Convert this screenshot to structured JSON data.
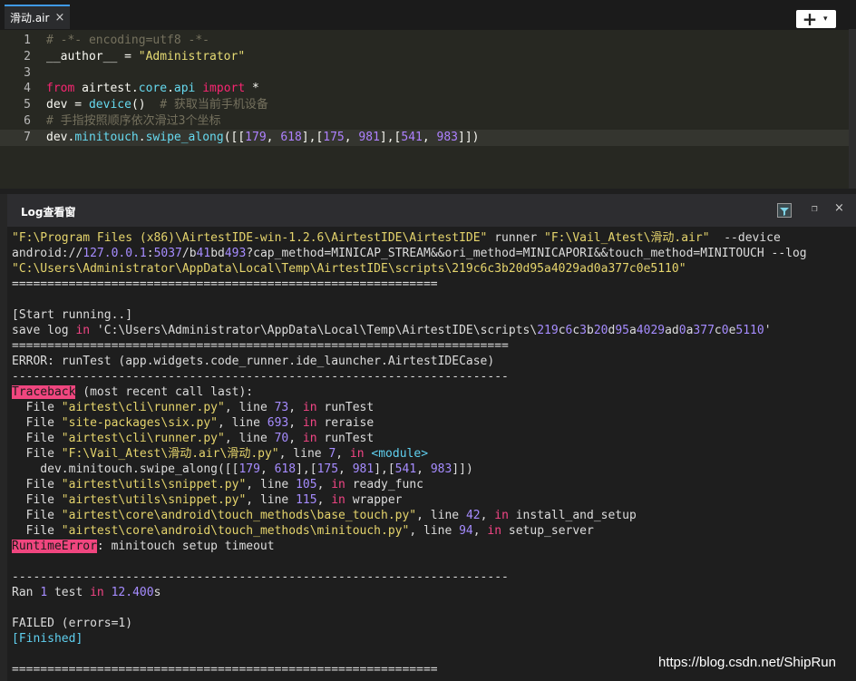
{
  "tab": {
    "title": "滑动.air",
    "close": "×"
  },
  "toolbar": {
    "add": "+",
    "dropdown": "▾"
  },
  "editor": {
    "lines": [
      {
        "num": "1",
        "parts": [
          [
            "c-comment",
            "# -*- encoding=utf8 -*-"
          ]
        ]
      },
      {
        "num": "2",
        "parts": [
          [
            "",
            "__author__ = "
          ],
          [
            "c-str",
            "\"Administrator\""
          ]
        ]
      },
      {
        "num": "3",
        "parts": [
          [
            "",
            ""
          ]
        ]
      },
      {
        "num": "4",
        "parts": [
          [
            "c-kw",
            "from"
          ],
          [
            "",
            " airtest."
          ],
          [
            "c-fn",
            "core"
          ],
          [
            "",
            "."
          ],
          [
            "c-fn",
            "api"
          ],
          [
            "",
            " "
          ],
          [
            "c-kw",
            "import"
          ],
          [
            "",
            " *"
          ]
        ]
      },
      {
        "num": "5",
        "parts": [
          [
            "",
            "dev = "
          ],
          [
            "c-fn",
            "device"
          ],
          [
            "",
            "()  "
          ],
          [
            "c-comment",
            "# 获取当前手机设备"
          ]
        ]
      },
      {
        "num": "6",
        "parts": [
          [
            "c-comment",
            "# 手指按照顺序依次滑过3个坐标"
          ]
        ]
      },
      {
        "num": "7",
        "current": true,
        "parts": [
          [
            "",
            "dev."
          ],
          [
            "c-fn",
            "minitouch"
          ],
          [
            "",
            "."
          ],
          [
            "c-fn",
            "swipe_along"
          ],
          [
            "",
            "([["
          ],
          [
            "c-num",
            "179"
          ],
          [
            "",
            ", "
          ],
          [
            "c-num",
            "618"
          ],
          [
            "",
            "],["
          ],
          [
            "c-num",
            "175"
          ],
          [
            "",
            ", "
          ],
          [
            "c-num",
            "981"
          ],
          [
            "",
            "],["
          ],
          [
            "c-num",
            "541"
          ],
          [
            "",
            ", "
          ],
          [
            "c-num",
            "983"
          ],
          [
            "",
            "]])"
          ]
        ]
      }
    ]
  },
  "log": {
    "title": "Log查看窗",
    "restore": "❐",
    "close": "×",
    "lines": [
      [
        [
          "y",
          "\"F:\\Program Files (x86)\\AirtestIDE-win-1.2.6\\AirtestIDE\\AirtestIDE\""
        ],
        [
          "",
          " runner "
        ],
        [
          "y",
          "\"F:\\Vail_Atest\\滑动.air\""
        ],
        [
          "",
          "  --device"
        ]
      ],
      [
        [
          "",
          "android://"
        ],
        [
          "n",
          "127.0.0.1"
        ],
        [
          "",
          ":"
        ],
        [
          "n",
          "5037"
        ],
        [
          "",
          "/b"
        ],
        [
          "n",
          "41"
        ],
        [
          "",
          "bd"
        ],
        [
          "n",
          "493"
        ],
        [
          "",
          "?cap_method=MINICAP_STREAM&&ori_method=MINICAPORI&&touch_method=MINITOUCH --log"
        ]
      ],
      [
        [
          "y",
          "\"C:\\Users\\Administrator\\AppData\\Local\\Temp\\AirtestIDE\\scripts\\219c6c3b20d95a4029ad0a377c0e5110\""
        ]
      ],
      [
        [
          "",
          "============================================================"
        ]
      ],
      [
        [
          "",
          ""
        ]
      ],
      [
        [
          "",
          "[Start running..]"
        ]
      ],
      [
        [
          "",
          "save log "
        ],
        [
          "k",
          "in"
        ],
        [
          "",
          " 'C:\\Users\\Administrator\\AppData\\Local\\Temp\\AirtestIDE\\scripts\\"
        ],
        [
          "n",
          "219"
        ],
        [
          "",
          "c"
        ],
        [
          "n",
          "6"
        ],
        [
          "",
          "c"
        ],
        [
          "n",
          "3"
        ],
        [
          "",
          "b"
        ],
        [
          "n",
          "20"
        ],
        [
          "",
          "d"
        ],
        [
          "n",
          "95"
        ],
        [
          "",
          "a"
        ],
        [
          "n",
          "4029"
        ],
        [
          "",
          "ad"
        ],
        [
          "n",
          "0"
        ],
        [
          "",
          "a"
        ],
        [
          "n",
          "377"
        ],
        [
          "",
          "c"
        ],
        [
          "n",
          "0"
        ],
        [
          "",
          "e"
        ],
        [
          "n",
          "5110"
        ],
        [
          "",
          "'"
        ]
      ],
      [
        [
          "",
          "======================================================================"
        ]
      ],
      [
        [
          "",
          "ERROR: runTest (app.widgets.code_runner.ide_launcher.AirtestIDECase)"
        ]
      ],
      [
        [
          "",
          "----------------------------------------------------------------------"
        ]
      ],
      [
        [
          "hl",
          "Traceback"
        ],
        [
          "",
          " (most recent call last):"
        ]
      ],
      [
        [
          "",
          "  File "
        ],
        [
          "y",
          "\"airtest\\cli\\runner.py\""
        ],
        [
          "",
          ", line "
        ],
        [
          "n",
          "73"
        ],
        [
          "",
          ", "
        ],
        [
          "k",
          "in"
        ],
        [
          "",
          " runTest"
        ]
      ],
      [
        [
          "",
          "  File "
        ],
        [
          "y",
          "\"site-packages\\six.py\""
        ],
        [
          "",
          ", line "
        ],
        [
          "n",
          "693"
        ],
        [
          "",
          ", "
        ],
        [
          "k",
          "in"
        ],
        [
          "",
          " reraise"
        ]
      ],
      [
        [
          "",
          "  File "
        ],
        [
          "y",
          "\"airtest\\cli\\runner.py\""
        ],
        [
          "",
          ", line "
        ],
        [
          "n",
          "70"
        ],
        [
          "",
          ", "
        ],
        [
          "k",
          "in"
        ],
        [
          "",
          " runTest"
        ]
      ],
      [
        [
          "",
          "  File "
        ],
        [
          "y",
          "\"F:\\Vail_Atest\\滑动.air\\滑动.py\""
        ],
        [
          "",
          ", line "
        ],
        [
          "n",
          "7"
        ],
        [
          "",
          ", "
        ],
        [
          "k",
          "in"
        ],
        [
          "",
          " "
        ],
        [
          "cy",
          "<module>"
        ]
      ],
      [
        [
          "",
          "    dev.minitouch.swipe_along([["
        ],
        [
          "n",
          "179"
        ],
        [
          "",
          ", "
        ],
        [
          "n",
          "618"
        ],
        [
          "",
          "],["
        ],
        [
          "n",
          "175"
        ],
        [
          "",
          ", "
        ],
        [
          "n",
          "981"
        ],
        [
          "",
          "],["
        ],
        [
          "n",
          "541"
        ],
        [
          "",
          ", "
        ],
        [
          "n",
          "983"
        ],
        [
          "",
          "]])"
        ]
      ],
      [
        [
          "",
          "  File "
        ],
        [
          "y",
          "\"airtest\\utils\\snippet.py\""
        ],
        [
          "",
          ", line "
        ],
        [
          "n",
          "105"
        ],
        [
          "",
          ", "
        ],
        [
          "k",
          "in"
        ],
        [
          "",
          " ready_func"
        ]
      ],
      [
        [
          "",
          "  File "
        ],
        [
          "y",
          "\"airtest\\utils\\snippet.py\""
        ],
        [
          "",
          ", line "
        ],
        [
          "n",
          "115"
        ],
        [
          "",
          ", "
        ],
        [
          "k",
          "in"
        ],
        [
          "",
          " wrapper"
        ]
      ],
      [
        [
          "",
          "  File "
        ],
        [
          "y",
          "\"airtest\\core\\android\\touch_methods\\base_touch.py\""
        ],
        [
          "",
          ", line "
        ],
        [
          "n",
          "42"
        ],
        [
          "",
          ", "
        ],
        [
          "k",
          "in"
        ],
        [
          "",
          " install_and_setup"
        ]
      ],
      [
        [
          "",
          "  File "
        ],
        [
          "y",
          "\"airtest\\core\\android\\touch_methods\\minitouch.py\""
        ],
        [
          "",
          ", line "
        ],
        [
          "n",
          "94"
        ],
        [
          "",
          ", "
        ],
        [
          "k",
          "in"
        ],
        [
          "",
          " setup_server"
        ]
      ],
      [
        [
          "hl",
          "RuntimeError"
        ],
        [
          "",
          ": minitouch setup timeout"
        ]
      ],
      [
        [
          "",
          ""
        ]
      ],
      [
        [
          "",
          "----------------------------------------------------------------------"
        ]
      ],
      [
        [
          "",
          "Ran "
        ],
        [
          "n",
          "1"
        ],
        [
          "",
          " test "
        ],
        [
          "k",
          "in"
        ],
        [
          "",
          " "
        ],
        [
          "n",
          "12.400"
        ],
        [
          "",
          "s"
        ]
      ],
      [
        [
          "",
          ""
        ]
      ],
      [
        [
          "",
          "FAILED (errors=1)"
        ]
      ],
      [
        [
          "cy",
          "[Finished]"
        ]
      ],
      [
        [
          "",
          ""
        ]
      ],
      [
        [
          "",
          "============================================================"
        ]
      ]
    ]
  },
  "watermark": "https://blog.csdn.net/ShipRun",
  "colors": {
    "editor_bg": "#272822",
    "log_bg": "#1e1e1e",
    "string": "#e6db74",
    "number": "#ae81ff",
    "keyword": "#f92672",
    "highlight": "#f0467f",
    "tab_accent": "#3f9ae5"
  }
}
